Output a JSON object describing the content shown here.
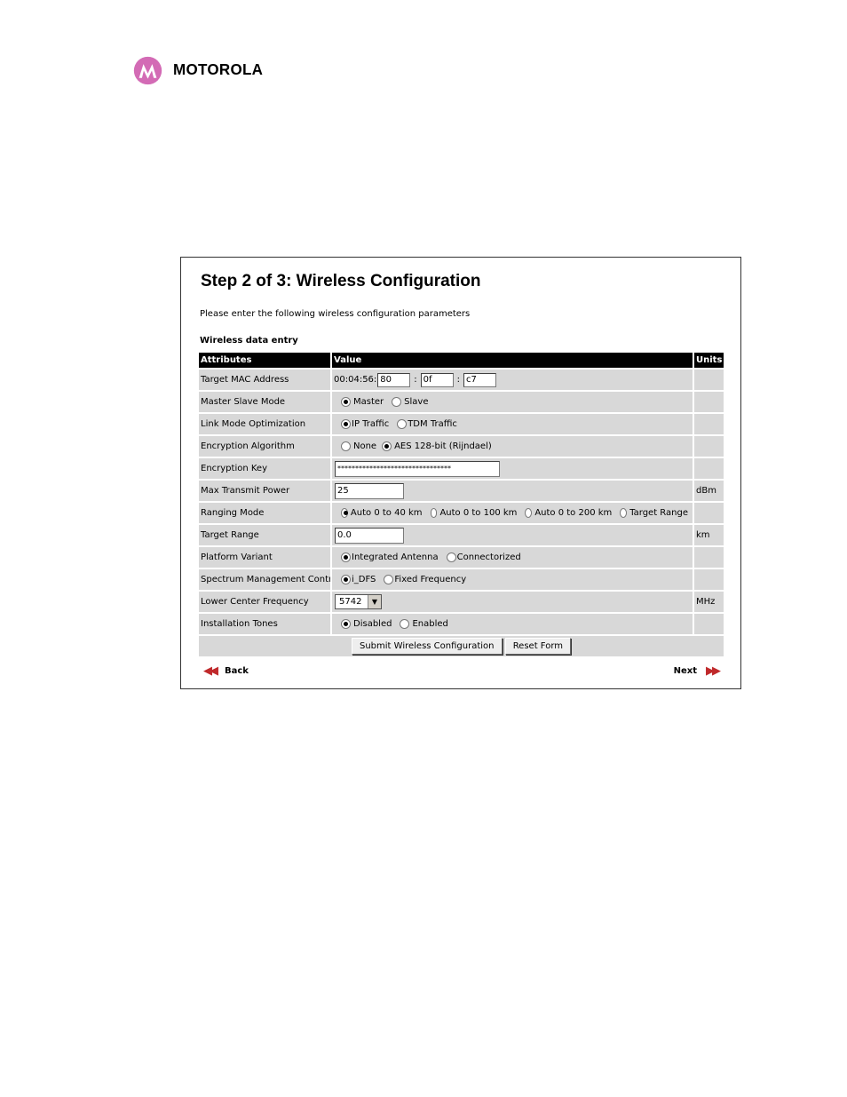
{
  "header": {
    "brand": "MOTOROLA",
    "brand_color": "#d36bb5",
    "icon": "motorola-logo"
  },
  "page": {
    "title": "Step 2 of 3: Wireless Configuration",
    "intro": "Please enter the following wireless configuration parameters",
    "section_label": "Wireless data entry"
  },
  "table": {
    "headers": [
      "Attributes",
      "Value",
      "Units"
    ],
    "rows": {
      "mac": {
        "label": "Target MAC Address",
        "prefix": "00:04:56:",
        "octets": [
          "80",
          "0f",
          "c7"
        ],
        "sep": ":"
      },
      "master_slave": {
        "label": "Master Slave Mode",
        "options": [
          "Master",
          "Slave"
        ],
        "selected": "Master"
      },
      "link_mode": {
        "label": "Link Mode Optimization",
        "options": [
          "IP Traffic",
          "TDM Traffic"
        ],
        "selected": "IP Traffic"
      },
      "encryption_algorithm": {
        "label": "Encryption Algorithm",
        "options": [
          "None",
          "AES 128-bit (Rijndael)"
        ],
        "selected": "AES 128-bit (Rijndael)"
      },
      "encryption_key": {
        "label": "Encryption Key",
        "value": "********************************"
      },
      "max_tx_power": {
        "label": "Max Transmit Power",
        "value": "25",
        "unit": "dBm"
      },
      "ranging_mode": {
        "label": "Ranging Mode",
        "options": [
          "Auto 0 to 40 km",
          "Auto 0 to 100 km",
          "Auto 0 to 200 km",
          "Target Range"
        ],
        "selected": "Auto 0 to 40 km"
      },
      "target_range": {
        "label": "Target Range",
        "value": "0.0",
        "unit": "km"
      },
      "platform_variant": {
        "label": "Platform Variant",
        "options": [
          "Integrated Antenna",
          "Connectorized"
        ],
        "selected": "Integrated Antenna"
      },
      "spectrum_mgmt": {
        "label": "Spectrum Management Control",
        "options": [
          "i_DFS",
          "Fixed Frequency"
        ],
        "selected": "i_DFS"
      },
      "lower_center_freq": {
        "label": "Lower Center Frequency",
        "value": "5742",
        "unit": "MHz"
      },
      "installation_tones": {
        "label": "Installation Tones",
        "options": [
          "Disabled",
          "Enabled"
        ],
        "selected": "Disabled"
      }
    }
  },
  "buttons": {
    "submit": "Submit Wireless Configuration",
    "reset": "Reset Form"
  },
  "nav": {
    "back": "Back",
    "next": "Next",
    "arrow_color": "#c0292b"
  }
}
